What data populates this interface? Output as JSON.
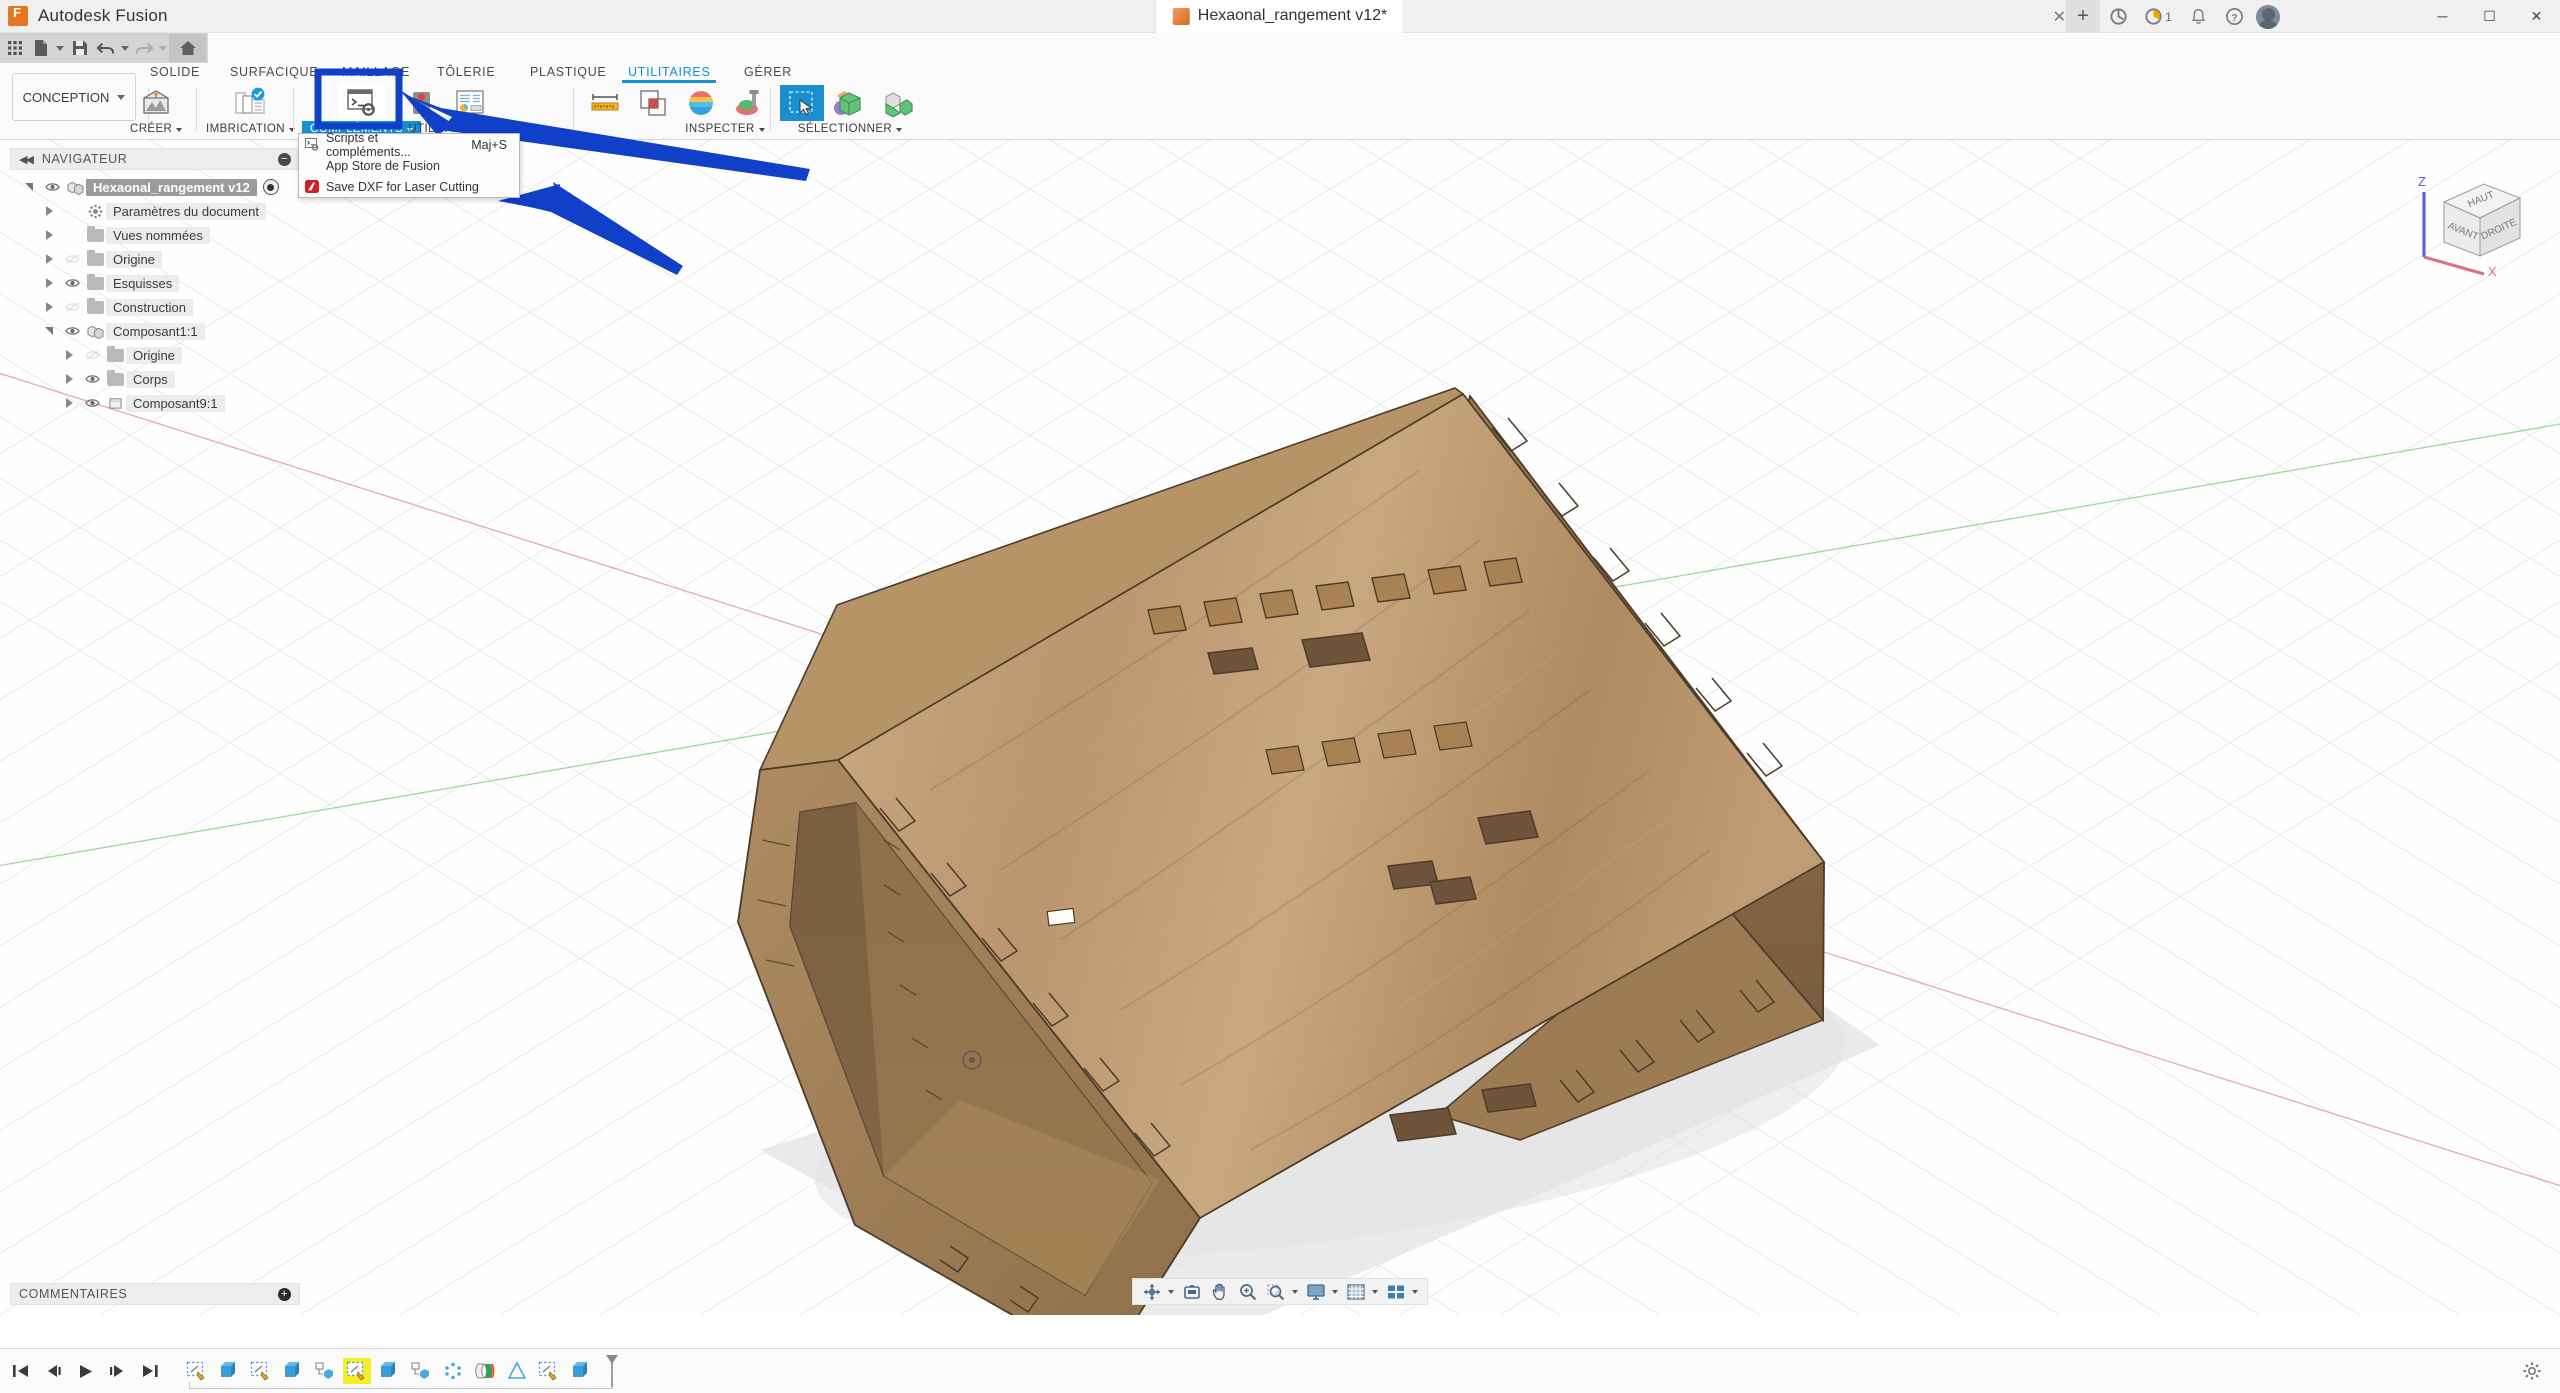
{
  "window": {
    "app_title": "Autodesk Fusion",
    "minimize": "─",
    "maximize": "☐",
    "close": "✕"
  },
  "document_tab": {
    "title": "Hexaonal_rangement v12*",
    "close": "✕",
    "new_tab": "+"
  },
  "account_bar": {
    "notifications_count": "1",
    "icons": [
      "sync-icon",
      "job-status-icon",
      "bell-icon",
      "help-icon",
      "avatar"
    ]
  },
  "quick_access": {
    "items": [
      {
        "name": "app-grid-icon",
        "label": ""
      },
      {
        "name": "file-icon",
        "label": ""
      },
      {
        "name": "save-icon",
        "label": ""
      },
      {
        "name": "undo-icon",
        "label": ""
      },
      {
        "name": "redo-icon",
        "label": ""
      },
      {
        "name": "home-icon",
        "label": ""
      }
    ]
  },
  "ribbon": {
    "workspace": {
      "label": "CONCEPTION",
      "caret": "▾"
    },
    "tabs": [
      {
        "label": "SOLIDE",
        "active": false
      },
      {
        "label": "SURFACIQUE",
        "active": false
      },
      {
        "label": "MAILLAGE",
        "active": false
      },
      {
        "label": "TÔLERIE",
        "active": false
      },
      {
        "label": "PLASTIQUE",
        "active": false
      },
      {
        "label": "UTILITAIRES",
        "active": true
      },
      {
        "label": "GÉRER",
        "active": false
      }
    ],
    "panels": [
      {
        "label": "CRÉER",
        "caret": "▾"
      },
      {
        "label": "IMBRICATION",
        "caret": "▾"
      },
      {
        "label": "COMPLÉMENTS",
        "caret": "▾",
        "selected": true
      },
      {
        "label": "UTILITAIRE",
        "caret": "▾"
      },
      {
        "label": "INSPECTER",
        "caret": "▾"
      },
      {
        "label": "SÉLECTIONNER",
        "caret": "▾"
      }
    ]
  },
  "dropdown_menu": {
    "items": [
      {
        "label": "Scripts et compléments...",
        "shortcut": "Maj+S",
        "icon": "script-icon"
      },
      {
        "label": "App Store de Fusion",
        "shortcut": "",
        "icon": ""
      },
      {
        "label": "Save DXF for Laser Cutting",
        "shortcut": "",
        "icon": "autodesk-a-icon"
      }
    ]
  },
  "navigator": {
    "title": "NAVIGATEUR",
    "collapse": "◀◀",
    "minus": "─",
    "tree": [
      {
        "label": "Hexaonal_rangement v12",
        "indent": 0,
        "expander": "open",
        "eye": "on",
        "icon": "component-icon",
        "selected": true,
        "radio": true
      },
      {
        "label": "Paramètres du document",
        "indent": 1,
        "expander": "closed",
        "eye": "none",
        "icon": "gear-icon",
        "selected": false,
        "radio": false
      },
      {
        "label": "Vues nommées",
        "indent": 1,
        "expander": "closed",
        "eye": "none",
        "icon": "folder-icon",
        "selected": false,
        "radio": false
      },
      {
        "label": "Origine",
        "indent": 1,
        "expander": "closed",
        "eye": "off",
        "icon": "folder-icon",
        "selected": false,
        "radio": false
      },
      {
        "label": "Esquisses",
        "indent": 1,
        "expander": "closed",
        "eye": "on",
        "icon": "folder-icon",
        "selected": false,
        "radio": false
      },
      {
        "label": "Construction",
        "indent": 1,
        "expander": "closed",
        "eye": "off",
        "icon": "folder-icon",
        "selected": false,
        "radio": false
      },
      {
        "label": "Composant1:1",
        "indent": 1,
        "expander": "open",
        "eye": "on",
        "icon": "component-icon",
        "selected": false,
        "radio": false
      },
      {
        "label": "Origine",
        "indent": 2,
        "expander": "closed",
        "eye": "off",
        "icon": "folder-icon",
        "selected": false,
        "radio": false
      },
      {
        "label": "Corps",
        "indent": 2,
        "expander": "closed",
        "eye": "on",
        "icon": "folder-icon",
        "selected": false,
        "radio": false
      },
      {
        "label": "Composant9:1",
        "indent": 2,
        "expander": "closed",
        "eye": "on",
        "icon": "body-icon",
        "selected": false,
        "radio": false
      }
    ]
  },
  "comments": {
    "title": "COMMENTAIRES",
    "plus": "+"
  },
  "view_toolbar": {
    "items": [
      {
        "name": "orbit-icon",
        "caret": true
      },
      {
        "name": "look-at-icon",
        "caret": false
      },
      {
        "name": "pan-icon",
        "caret": false
      },
      {
        "name": "zoom-icon",
        "caret": false
      },
      {
        "name": "zoom-window-icon",
        "caret": true
      },
      {
        "name": "display-settings-icon",
        "caret": true
      },
      {
        "name": "grid-snaps-icon",
        "caret": true
      },
      {
        "name": "viewports-icon",
        "caret": true
      }
    ]
  },
  "viewcube": {
    "top_face": "HAUT",
    "front_face": "AVANT",
    "right_face": "DROITE",
    "axis_z": "Z",
    "axis_x": "X"
  },
  "timeline": {
    "nav_buttons": [
      "skip-start-icon",
      "step-back-icon",
      "play-icon",
      "step-forward-icon",
      "skip-end-icon"
    ],
    "features": [
      {
        "name": "sketch-feature",
        "highlighted": false
      },
      {
        "name": "extrude-feature",
        "highlighted": false
      },
      {
        "name": "sketch-feature",
        "highlighted": false
      },
      {
        "name": "extrude-feature",
        "highlighted": false
      },
      {
        "name": "component-feature",
        "highlighted": false
      },
      {
        "name": "sketch-feature",
        "highlighted": true
      },
      {
        "name": "extrude-feature",
        "highlighted": false
      },
      {
        "name": "component-feature",
        "highlighted": false
      },
      {
        "name": "pattern-feature",
        "highlighted": false
      },
      {
        "name": "appearance-feature",
        "highlighted": false
      },
      {
        "name": "chamfer-feature",
        "highlighted": false
      },
      {
        "name": "sketch-feature",
        "highlighted": false
      },
      {
        "name": "extrude-feature",
        "highlighted": false
      }
    ]
  },
  "colors": {
    "accent": "#1592cf",
    "arrow": "#1040c8",
    "highlight": "#f5ef2a",
    "wood_light": "#c9a071",
    "wood_mid": "#b18a5d",
    "wood_dark": "#8f6d46",
    "wood_shadow": "#6e5336",
    "titlebar": "#f0f0f0",
    "qat": "#d4d4d4"
  },
  "model": {
    "name": "hexagonal storage box",
    "description": "Laser-cut plywood hexagonal prism box shown in isometric 3D view"
  }
}
